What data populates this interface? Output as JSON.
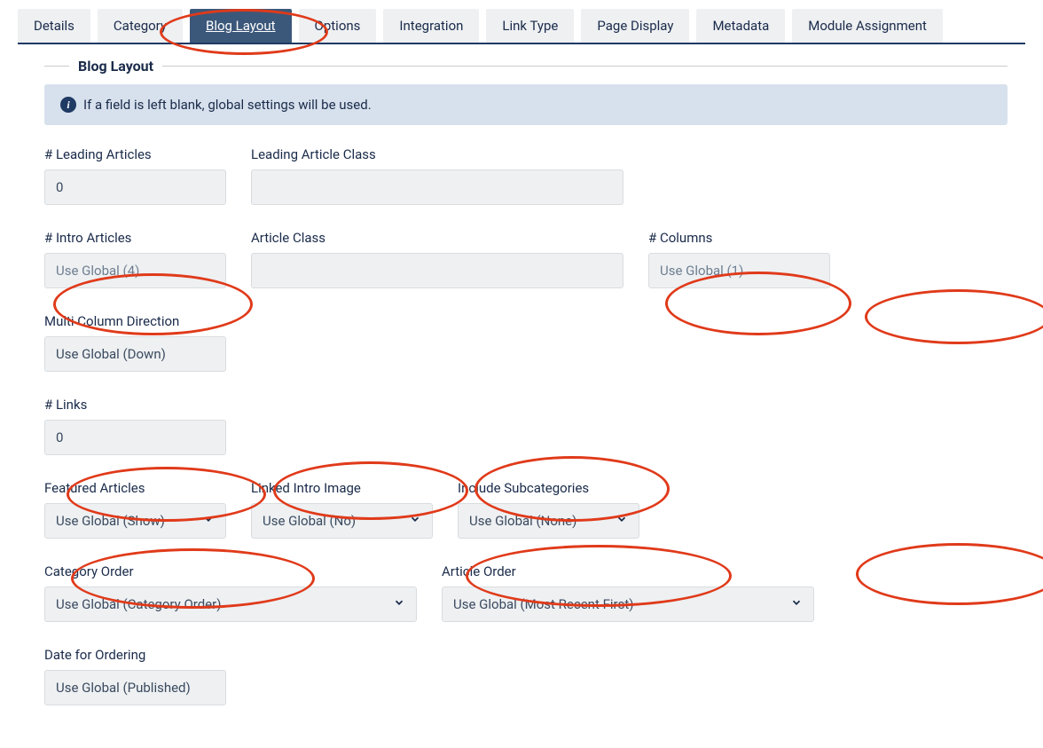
{
  "tabs": [
    {
      "label": "Details"
    },
    {
      "label": "Category"
    },
    {
      "label": "Blog Layout"
    },
    {
      "label": "Options"
    },
    {
      "label": "Integration"
    },
    {
      "label": "Link Type"
    },
    {
      "label": "Page Display"
    },
    {
      "label": "Metadata"
    },
    {
      "label": "Module Assignment"
    }
  ],
  "activeTabIndex": 2,
  "panel": {
    "legend": "Blog Layout",
    "info": "If a field is left blank, global settings will be used."
  },
  "fields": {
    "leading_articles": {
      "label": "# Leading Articles",
      "value": "0"
    },
    "leading_class": {
      "label": "Leading Article Class",
      "value": ""
    },
    "intro_articles": {
      "label": "# Intro Articles",
      "placeholder": "Use Global (4)"
    },
    "article_class": {
      "label": "Article Class",
      "value": ""
    },
    "columns": {
      "label": "# Columns",
      "placeholder": "Use Global (1)"
    },
    "multi_col_dir": {
      "label": "Multi Column Direction",
      "value": "Use Global (Down)"
    },
    "links": {
      "label": "# Links",
      "value": "0"
    },
    "featured": {
      "label": "Featured Articles",
      "value": "Use Global (Show)"
    },
    "linked_intro": {
      "label": "Linked Intro Image",
      "value": "Use Global (No)"
    },
    "include_subcat": {
      "label": "Include Subcategories",
      "value": "Use Global (None)"
    },
    "category_order": {
      "label": "Category Order",
      "value": "Use Global (Category Order)"
    },
    "article_order": {
      "label": "Article Order",
      "value": "Use Global (Most Recent First)"
    },
    "date_ordering": {
      "label": "Date for Ordering",
      "value": "Use Global (Published)"
    }
  }
}
